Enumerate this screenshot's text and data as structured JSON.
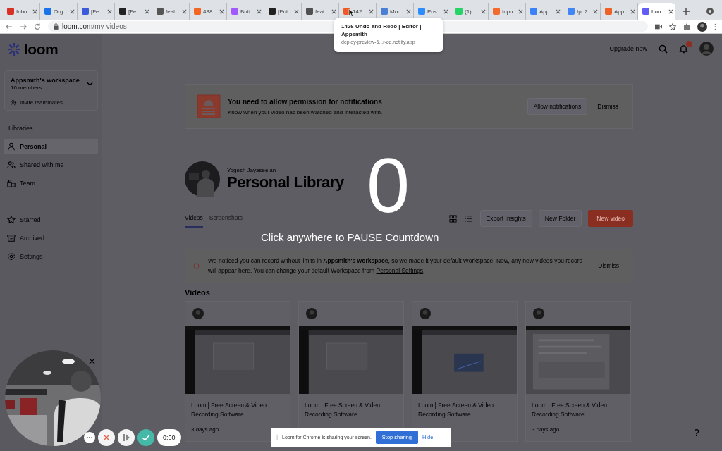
{
  "browser": {
    "tabs": [
      {
        "label": "Inbo",
        "color": "#d93025",
        "selected": false
      },
      {
        "label": "Org",
        "color": "#1a73e8",
        "selected": false
      },
      {
        "label": "[Fe",
        "color": "#3b5bdb",
        "selected": false
      },
      {
        "label": "[Fe",
        "color": "#222222",
        "selected": false
      },
      {
        "label": "feat",
        "color": "#555555",
        "selected": false
      },
      {
        "label": "488",
        "color": "#f26522",
        "selected": false
      },
      {
        "label": "Butt",
        "color": "#a259ff",
        "selected": false
      },
      {
        "label": "[Eni",
        "color": "#202020",
        "selected": false
      },
      {
        "label": "feat",
        "color": "#505050",
        "selected": false
      },
      {
        "label": "142",
        "color": "#f05a28",
        "selected": false
      },
      {
        "label": "Moc",
        "color": "#4a7fd6",
        "selected": false
      },
      {
        "label": "Pos",
        "color": "#2d8cff",
        "selected": false
      },
      {
        "label": "(1)",
        "color": "#25d366",
        "selected": false
      },
      {
        "label": "Inpu",
        "color": "#f36a2a",
        "selected": false
      },
      {
        "label": "App",
        "color": "#3b82f6",
        "selected": false
      },
      {
        "label": "Ipl 2",
        "color": "#4285f4",
        "selected": false
      },
      {
        "label": "App",
        "color": "#ef6024",
        "selected": false
      },
      {
        "label": "Loo",
        "color": "#625df5",
        "selected": true
      }
    ],
    "tooltip": {
      "title": "1426 Undo and Redo | Editor | Appsmith",
      "url": "deploy-preview-6...r-ce.netlify.app"
    },
    "address": {
      "host": "loom.com",
      "path": "/my-videos"
    }
  },
  "app": {
    "logo": "loom",
    "upgrade": "Upgrade now",
    "workspace": {
      "name": "Appsmith's workspace",
      "members": "16 members",
      "invite": "Invite teammates"
    },
    "sidebar": {
      "heading": "Libraries",
      "items": [
        {
          "label": "Personal",
          "selected": true
        },
        {
          "label": "Shared with me",
          "selected": false
        },
        {
          "label": "Team",
          "selected": false
        },
        {
          "label": "Starred",
          "selected": false
        },
        {
          "label": "Archived",
          "selected": false
        },
        {
          "label": "Settings",
          "selected": false
        }
      ]
    },
    "notice": {
      "title": "You need to allow permission for notifications",
      "text": "Know when your video has been watched and interacted with.",
      "allow": "Allow notifications",
      "dismiss": "Dismiss"
    },
    "owner": "Yogesh Jayaseelan",
    "library_title": "Personal Library",
    "tabs": [
      {
        "label": "Videos",
        "selected": true
      },
      {
        "label": "Screenshots",
        "selected": false
      }
    ],
    "actions": {
      "export": "Export Insights",
      "folder": "New Folder",
      "new_video": "New video"
    },
    "workspace_notice": {
      "text": "We noticed you can record without limits in **Appsmith's workspace**, so we made it your default Workspace. Now, any new videos you record will appear here. You can change your default Workspace from",
      "link": "Personal Settings",
      "end": ".",
      "dismiss": "Dismiss"
    },
    "videos_heading": "Videos",
    "videos": [
      {
        "title": "Loom | Free Screen & Video Recording Software",
        "age": "3 days ago"
      },
      {
        "title": "Loom | Free Screen & Video Recording Software"
      },
      {
        "title": "Loom | Free Screen & Video Recording Software"
      },
      {
        "title": "Loom | Free Screen & Video Recording Software",
        "age": "3 days ago"
      }
    ]
  },
  "recording": {
    "countdown": "0",
    "hint": "Click anywhere to PAUSE Countdown",
    "timer": "0:00",
    "share_bar": {
      "text": "Loom for Chrome is sharing your screen.",
      "stop": "Stop sharing",
      "hide": "Hide"
    },
    "help": "?"
  }
}
